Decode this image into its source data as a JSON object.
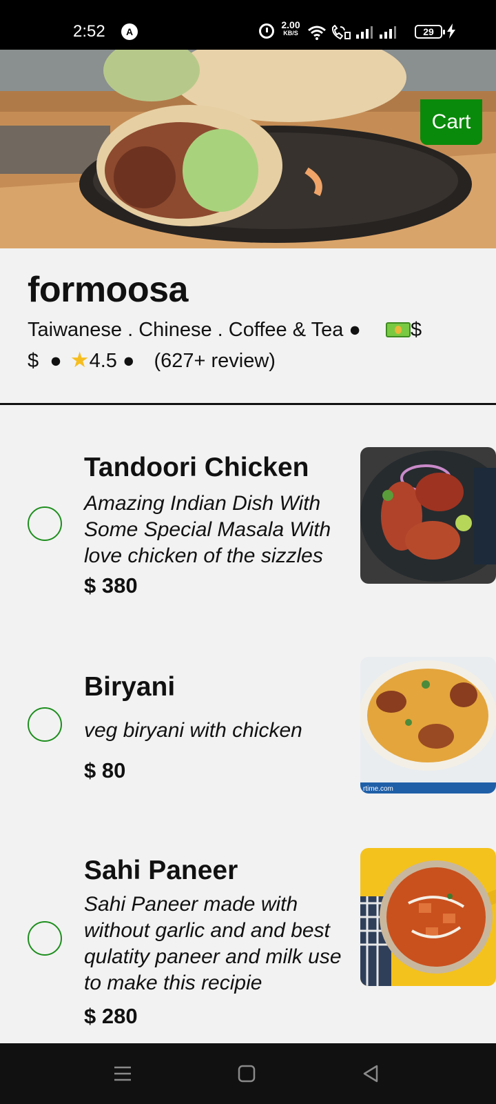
{
  "status_bar": {
    "time": "2:52",
    "a_badge": "A",
    "net_speed_value": "2.00",
    "net_speed_unit": "KB/S",
    "battery_level": "29",
    "icons": [
      "alarm-icon",
      "wifi-icon",
      "call-icon",
      "signal-icon",
      "signal-icon",
      "battery-icon",
      "charging-bolt-icon"
    ]
  },
  "hero": {
    "cart_label": "Cart",
    "cart_color": "#0a8a0a"
  },
  "restaurant": {
    "name": "formoosa",
    "meta_line1": "Taiwanese . Chinese . Coffee & Tea ●",
    "meta_dollar_tail": "$",
    "meta_line2_start": "$  ●",
    "rating": "4.5",
    "meta_line2_sep": " ●",
    "reviews": "(627+ review)"
  },
  "menu": {
    "items": [
      {
        "title": "Tandoori Chicken",
        "description": "Amazing Indian Dish With Some Special Masala With love chicken of the sizzles",
        "price": "$ 380"
      },
      {
        "title": "Biryani",
        "description": "veg biryani with chicken",
        "price": "$ 80",
        "image_caption": "rtime.com"
      },
      {
        "title": "Sahi Paneer",
        "description": "Sahi Paneer made with without garlic and and best qulatity paneer and milk use to make this recipie",
        "price": "$ 280"
      }
    ],
    "radio_color": "#1d8e1d"
  },
  "nav_bar": {
    "icons": [
      "menu-icon",
      "home-icon",
      "back-icon"
    ]
  }
}
